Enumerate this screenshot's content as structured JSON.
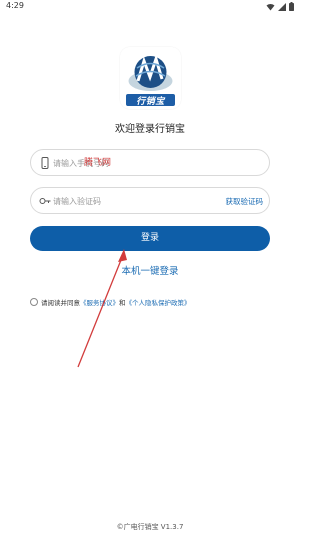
{
  "status_bar": {
    "time": "4:29",
    "icons": [
      "wifi-icon",
      "signal-icon",
      "battery-icon"
    ]
  },
  "app": {
    "logo_text": "行销宝",
    "welcome": "欢迎登录行销宝"
  },
  "form": {
    "phone_placeholder": "请输入手机号码",
    "code_placeholder": "请输入验证码",
    "get_code_label": "获取验证码",
    "login_label": "登录",
    "onekey_label": "本机一键登录"
  },
  "agreement": {
    "prefix": "请阅读并同意",
    "service_link": "《服务协议》",
    "and": "和",
    "privacy_link": "《个人隐私保护政策》"
  },
  "watermark": "腾飞网",
  "footer": "©广电行销宝 V1.3.7",
  "colors": {
    "primary": "#0e5ea8",
    "link": "#1a6bb3",
    "annotation": "#d23c3c"
  }
}
